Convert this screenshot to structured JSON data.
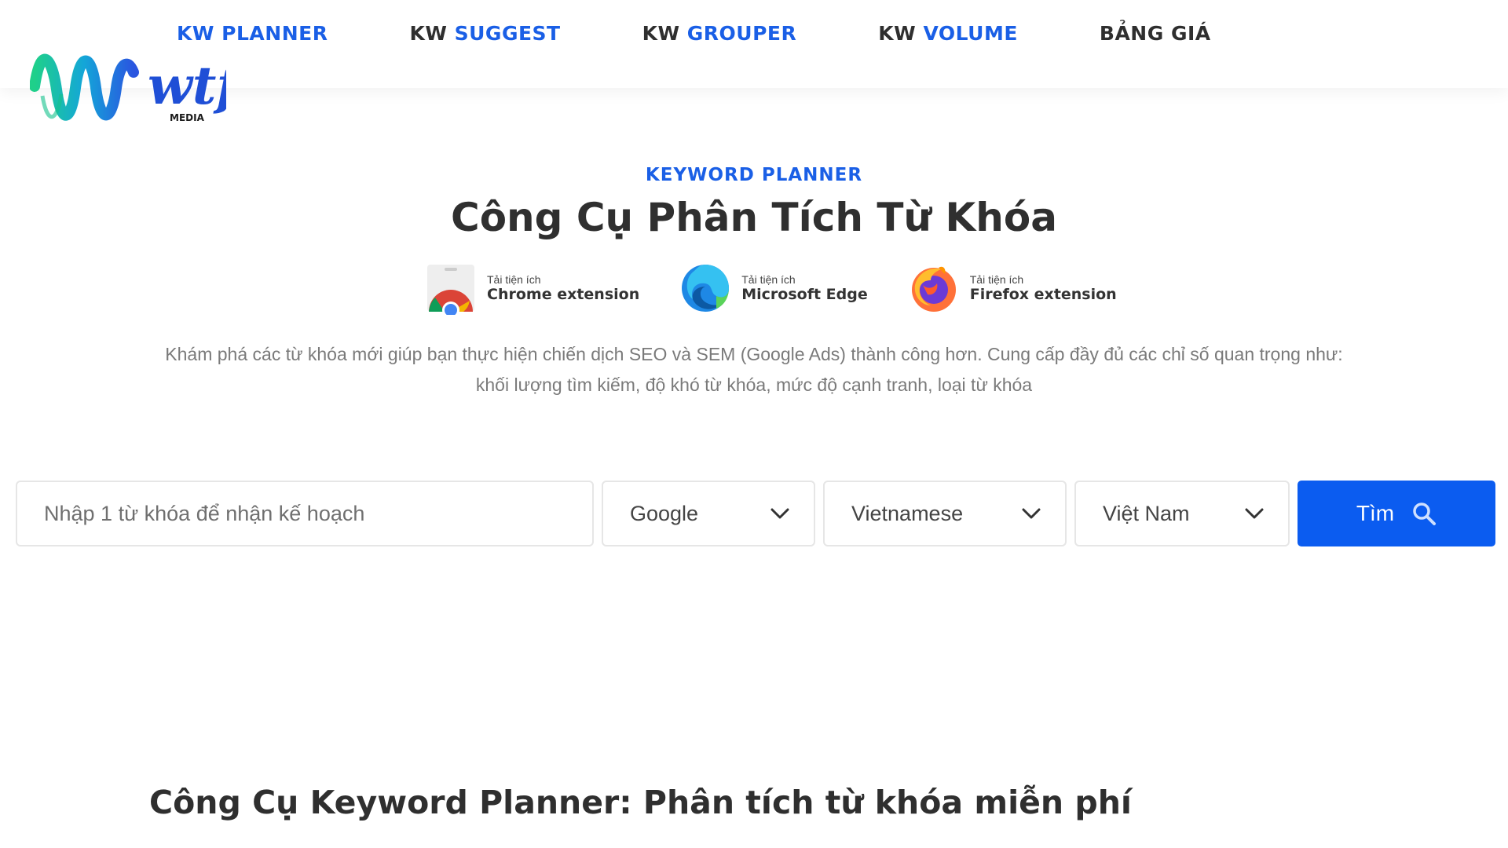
{
  "brand": {
    "logo_text": "wtf",
    "logo_sub": "MEDIA"
  },
  "nav": {
    "items": [
      {
        "prefix": "KW",
        "highlight": "PLANNER"
      },
      {
        "prefix": "KW",
        "highlight": "SUGGEST"
      },
      {
        "prefix": "KW",
        "highlight": "GROUPER"
      },
      {
        "prefix": "KW",
        "highlight": "VOLUME"
      },
      {
        "prefix": "BẢNG GIÁ",
        "highlight": ""
      }
    ]
  },
  "hero": {
    "eyebrow": "KEYWORD PLANNER",
    "title": "Công Cụ Phân Tích Từ Khóa",
    "description": "Khám phá các từ khóa mới giúp bạn thực hiện chiến dịch SEO và SEM (Google Ads) thành công hơn. Cung cấp đầy đủ các chỉ số quan trọng như: khối lượng tìm kiếm, độ khó từ khóa, mức độ cạnh tranh, loại từ khóa"
  },
  "extensions": [
    {
      "small": "Tải tiện ích",
      "big": "Chrome extension"
    },
    {
      "small": "Tải tiện ích",
      "big": "Microsoft Edge"
    },
    {
      "small": "Tải tiện ích",
      "big": "Firefox extension"
    }
  ],
  "search": {
    "placeholder": "Nhập 1 từ khóa để nhận kế hoạch",
    "engine": "Google",
    "language": "Vietnamese",
    "country": "Việt Nam",
    "button_label": "Tìm"
  },
  "section": {
    "title": "Công Cụ Keyword Planner: Phân tích từ khóa miễn phí"
  },
  "colors": {
    "accent": "#1a5fe6",
    "button": "#0b5cf0",
    "text": "#2f2f2f",
    "muted": "#7a7a7a"
  }
}
